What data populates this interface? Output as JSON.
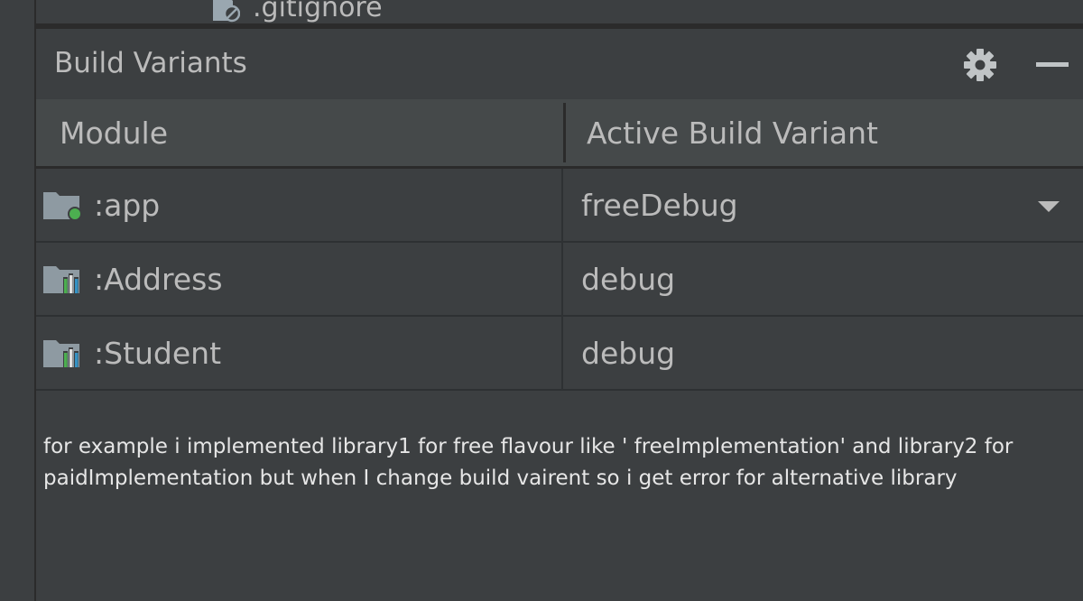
{
  "project_tree": {
    "item_label": ".gitignore",
    "item_icon": "ignored-file-icon"
  },
  "panel": {
    "title": "Build Variants",
    "settings_icon": "gear-icon",
    "minimize_icon": "minimize-icon"
  },
  "table": {
    "headers": [
      "Module",
      "Active Build Variant"
    ],
    "rows": [
      {
        "module": ":app",
        "icon": "app-module-icon",
        "variant": "freeDebug",
        "has_dropdown": true
      },
      {
        "module": ":Address",
        "icon": "library-module-icon",
        "variant": "debug",
        "has_dropdown": false
      },
      {
        "module": ":Student",
        "icon": "library-module-icon",
        "variant": "debug",
        "has_dropdown": false
      }
    ]
  },
  "note_text": "for example i implemented library1 for free flavour like ' freeImplementation' and library2 for paidImplementation but when I change build vairent so i get error for alternative library",
  "colors": {
    "panel_bg": "#3c3f41",
    "header_bg": "#45494a",
    "text": "#bbbbbb",
    "app_dot": "#4caf50",
    "bar_green": "#4caf50",
    "bar_blue": "#3592c4"
  }
}
